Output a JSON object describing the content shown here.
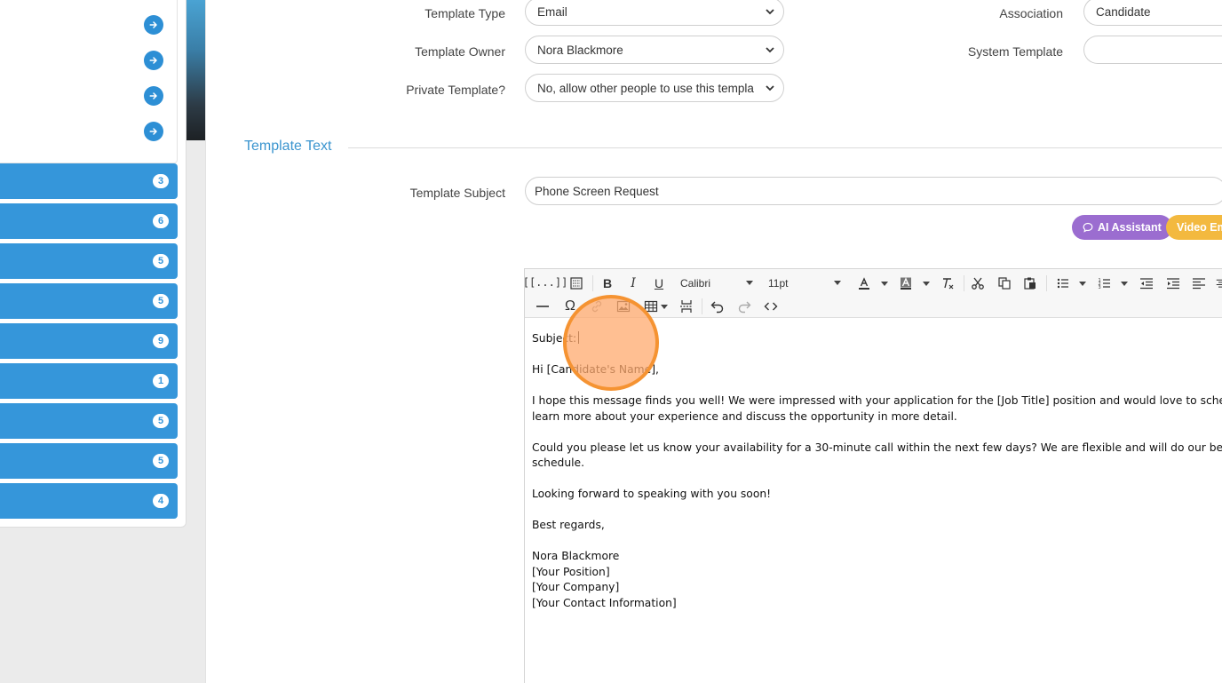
{
  "sidebar": {
    "rows": [
      {
        "badge": "3"
      },
      {
        "badge": "6"
      },
      {
        "badge": "5"
      },
      {
        "badge": "5"
      },
      {
        "badge": "9"
      },
      {
        "badge": "1"
      },
      {
        "badge": "5"
      },
      {
        "badge": "5"
      },
      {
        "badge": "4"
      }
    ]
  },
  "form": {
    "template_type": {
      "label": "Template Type",
      "value": "Email"
    },
    "template_owner": {
      "label": "Template Owner",
      "value": "Nora Blackmore"
    },
    "private_template": {
      "label": "Private Template?",
      "value": "No, allow other people to use this templa"
    },
    "association": {
      "label": "Association",
      "value": "Candidate"
    },
    "system_template": {
      "label": "System Template",
      "value": ""
    }
  },
  "section": {
    "title": "Template Text"
  },
  "subject": {
    "label": "Template Subject",
    "value": "Phone Screen Request"
  },
  "buttons": {
    "ai_assistant": "AI Assistant",
    "video_email": "Video Em"
  },
  "toolbar": {
    "font_family": "Calibri",
    "font_size": "11pt"
  },
  "editor": {
    "line_subject": "Subject:",
    "line_greeting": "Hi [Candidate's Name],",
    "line_p1a": "I hope this message finds you well! We were impressed with your application for the [Job Title] position and would love to schedule",
    "line_p1b": "learn more about your experience and discuss the opportunity in more detail.",
    "line_p2a": "Could you please let us know your availability for a 30-minute call within the next few days? We are flexible and will do our best to a",
    "line_p2b": "schedule.",
    "line_p3": "Looking forward to speaking with you soon!",
    "line_closing": "Best regards,",
    "sig_name": "Nora Blackmore",
    "sig_position": "[Your Position]",
    "sig_company": "[Your Company]",
    "sig_contact": "[Your Contact Information]"
  },
  "colors": {
    "accent": "#3596da",
    "ai_button": "#9b6dd0",
    "video_button": "#f3b93f",
    "click_marker": "#f59332"
  }
}
